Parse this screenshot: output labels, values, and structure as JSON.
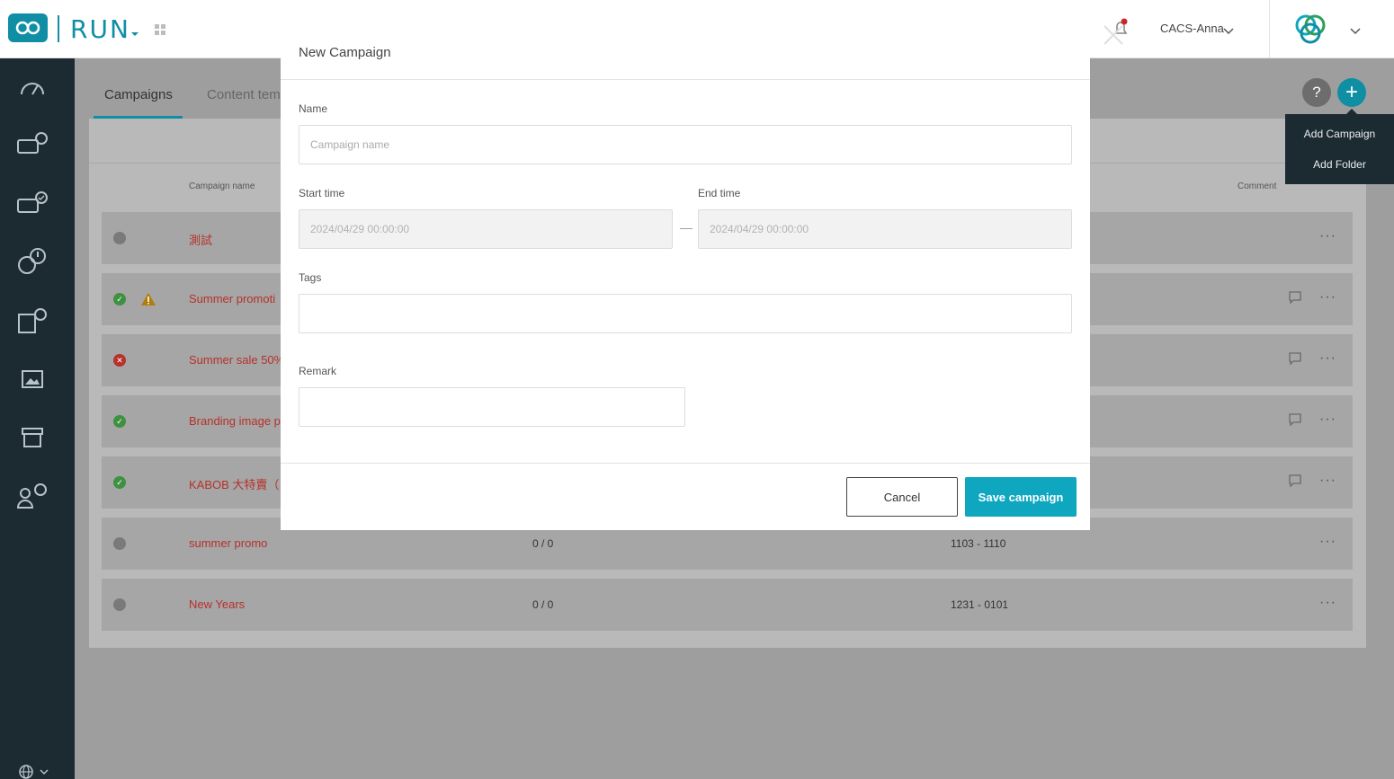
{
  "app": {
    "name": "RUN"
  },
  "header": {
    "user_name": "CACS-Anna"
  },
  "tabs": [
    {
      "label": "Campaigns"
    },
    {
      "label": "Content tem"
    }
  ],
  "actions": {
    "help_label": "?",
    "add_label": "+"
  },
  "add_menu": {
    "items": [
      {
        "label": "Add Campaign"
      },
      {
        "label": "Add Folder"
      }
    ]
  },
  "table": {
    "headers": {
      "name": "Campaign name",
      "comment": "Comment"
    },
    "rows": [
      {
        "status": "inactive",
        "name": "測試",
        "count": "",
        "date": ""
      },
      {
        "status": "active",
        "warning": true,
        "name": "Summer promoti",
        "count": "",
        "date": ""
      },
      {
        "status": "error",
        "name": "Summer sale 50%",
        "count": "",
        "date": ""
      },
      {
        "status": "active",
        "name": "Branding image p",
        "count": "",
        "date": ""
      },
      {
        "status": "active",
        "name": "KABOB 大特賣（",
        "count": "",
        "date": ""
      },
      {
        "status": "inactive",
        "name": "summer promo",
        "count": "0 / 0",
        "date": "1103 - 1110"
      },
      {
        "status": "inactive",
        "name": "New Years",
        "count": "0 / 0",
        "date": "1231 - 0101"
      }
    ]
  },
  "modal": {
    "title": "New Campaign",
    "name_label": "Name",
    "name_placeholder": "Campaign name",
    "start_label": "Start time",
    "start_value": "2024/04/29 00:00:00",
    "dash": "—",
    "end_label": "End time",
    "end_value": "2024/04/29 00:00:00",
    "tags_label": "Tags",
    "remark_label": "Remark",
    "cancel_label": "Cancel",
    "save_label": "Save campaign"
  }
}
